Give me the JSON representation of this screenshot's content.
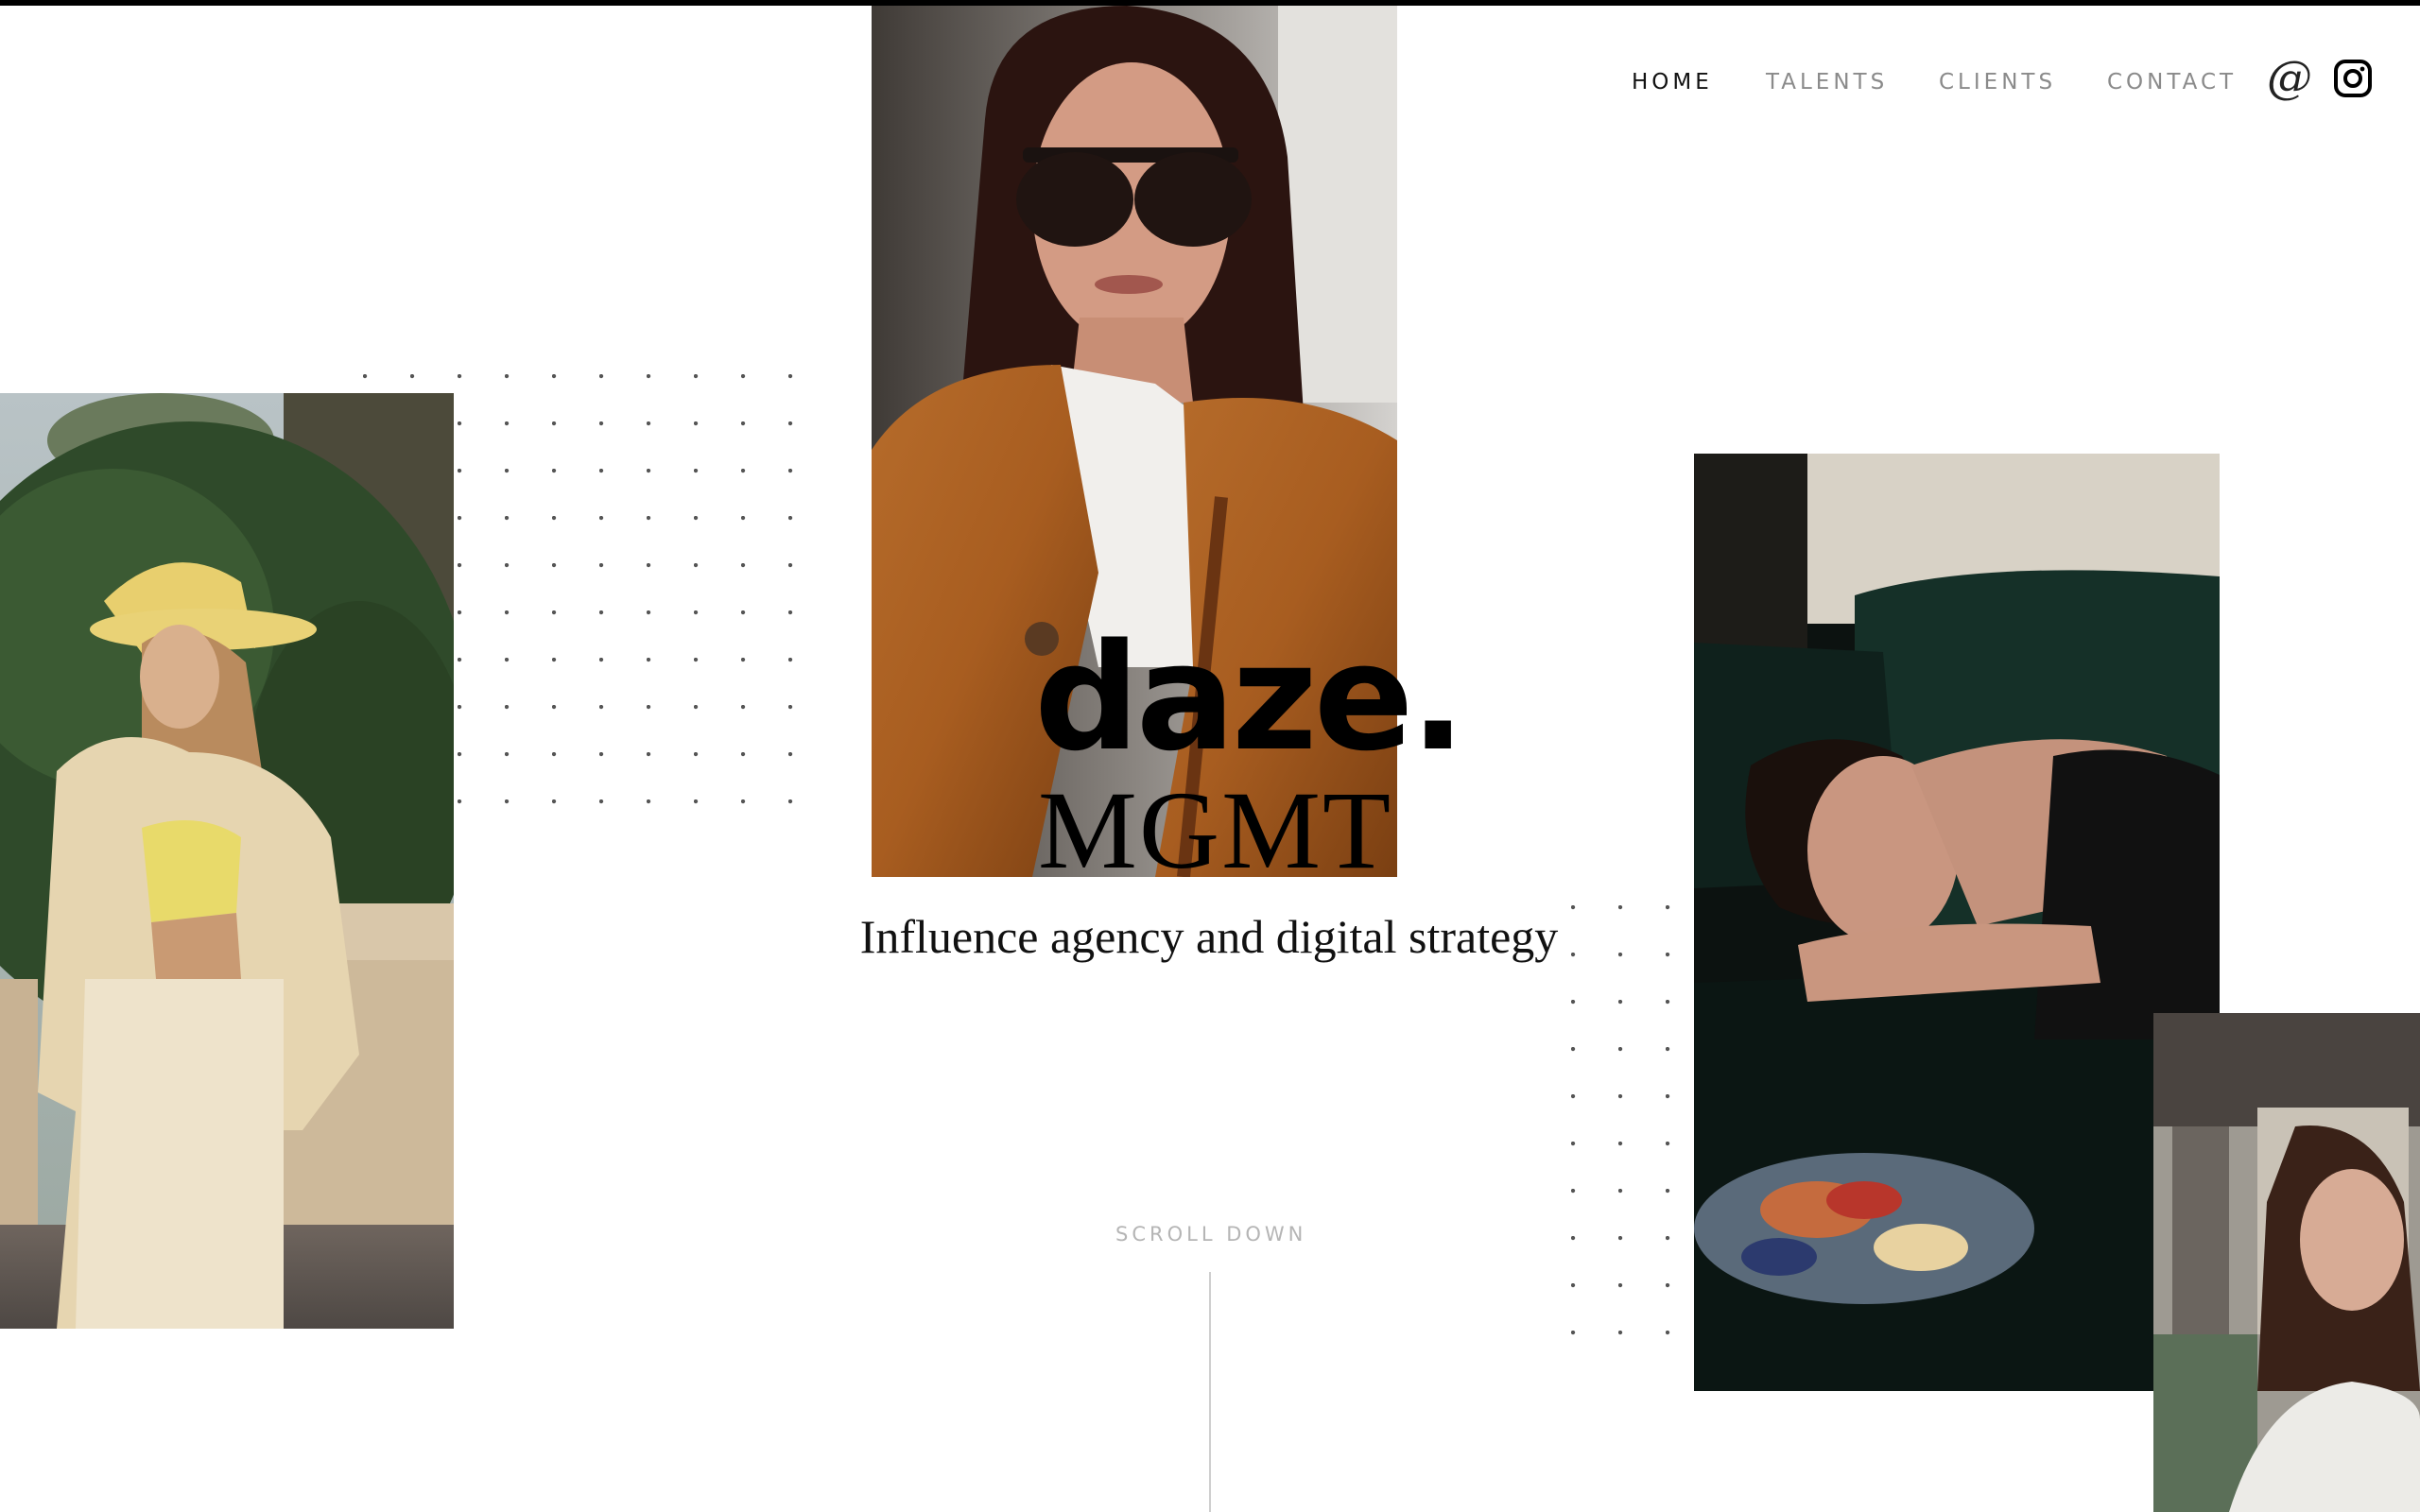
{
  "nav": {
    "items": [
      {
        "label": "HOME",
        "active": true
      },
      {
        "label": "TALENTS",
        "active": false
      },
      {
        "label": "CLIENTS",
        "active": false
      },
      {
        "label": "CONTACT",
        "active": false
      }
    ],
    "email_icon": "at-sign-icon",
    "social_icon": "instagram-icon"
  },
  "brand": {
    "name": "daze.",
    "sub": "MGMT",
    "tagline": "Influence agency and digital strategy"
  },
  "scroll": {
    "label": "SCROLL DOWN"
  },
  "photos": [
    {
      "name": "hero-photo-leather-coat"
    },
    {
      "name": "photo-yellow-cap"
    },
    {
      "name": "photo-palette-sofa"
    },
    {
      "name": "photo-street"
    }
  ]
}
